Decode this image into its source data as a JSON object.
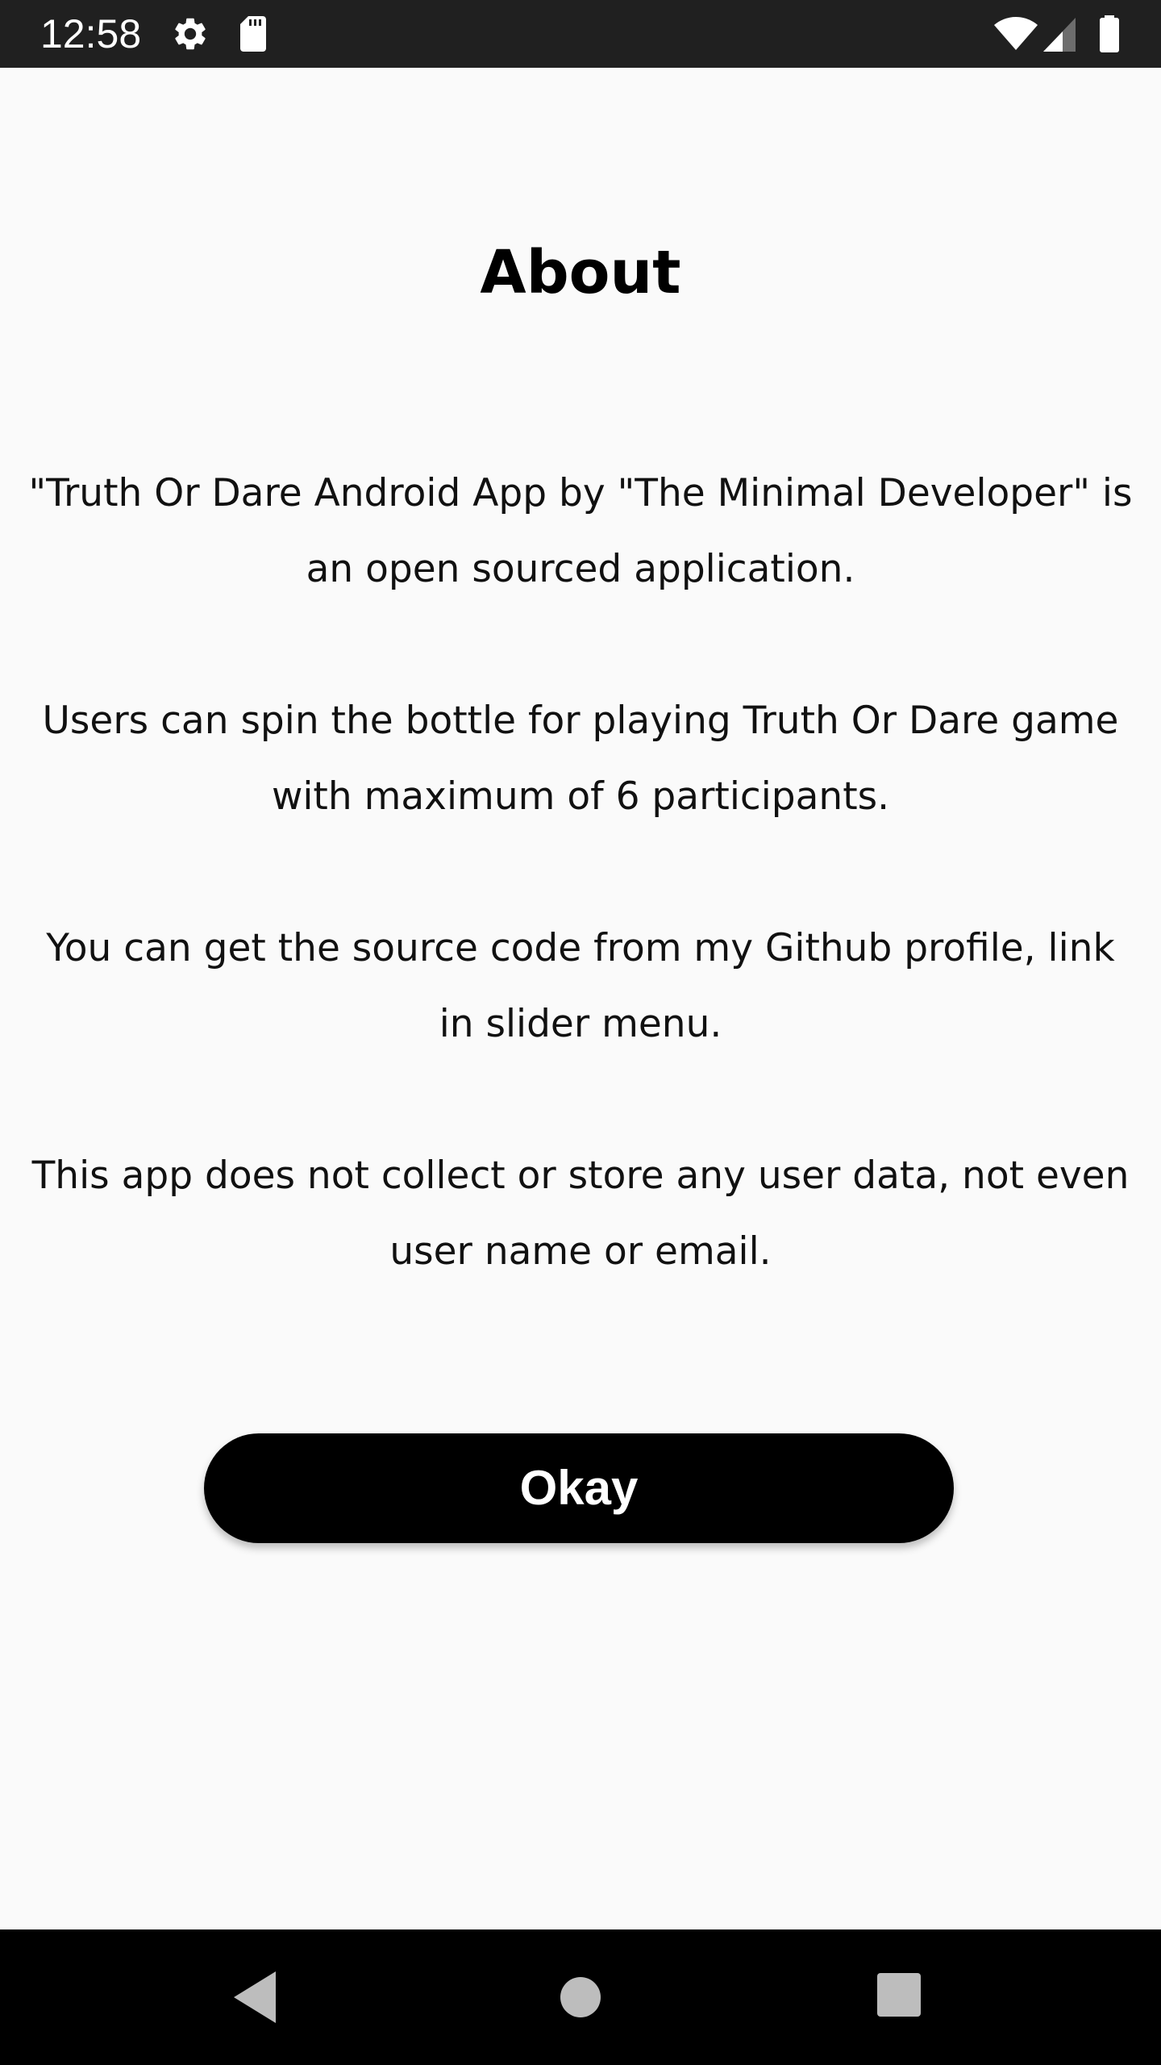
{
  "status_bar": {
    "time": "12:58",
    "icons": [
      "gear-icon",
      "sd-card-icon",
      "wifi-icon",
      "cell-signal-icon",
      "battery-icon"
    ]
  },
  "about": {
    "title": "About",
    "paragraphs": [
      "\"Truth Or Dare Android App by \"The Minimal Developer\" is an open sourced application.",
      "Users can spin the bottle for playing Truth Or Dare game with maximum of 6 participants.",
      "You can get the source code from my Github profile, link in slider menu.",
      "This app does not collect or store any user data, not even user name or email."
    ],
    "okay_label": "Okay"
  },
  "nav_bar": {
    "icons": [
      "back-icon",
      "home-icon",
      "recents-icon"
    ]
  },
  "colors": {
    "status_bar_bg": "#202020",
    "page_bg": "#fafafa",
    "button_bg": "#000000",
    "button_text": "#ffffff",
    "nav_bar_bg": "#000000"
  }
}
